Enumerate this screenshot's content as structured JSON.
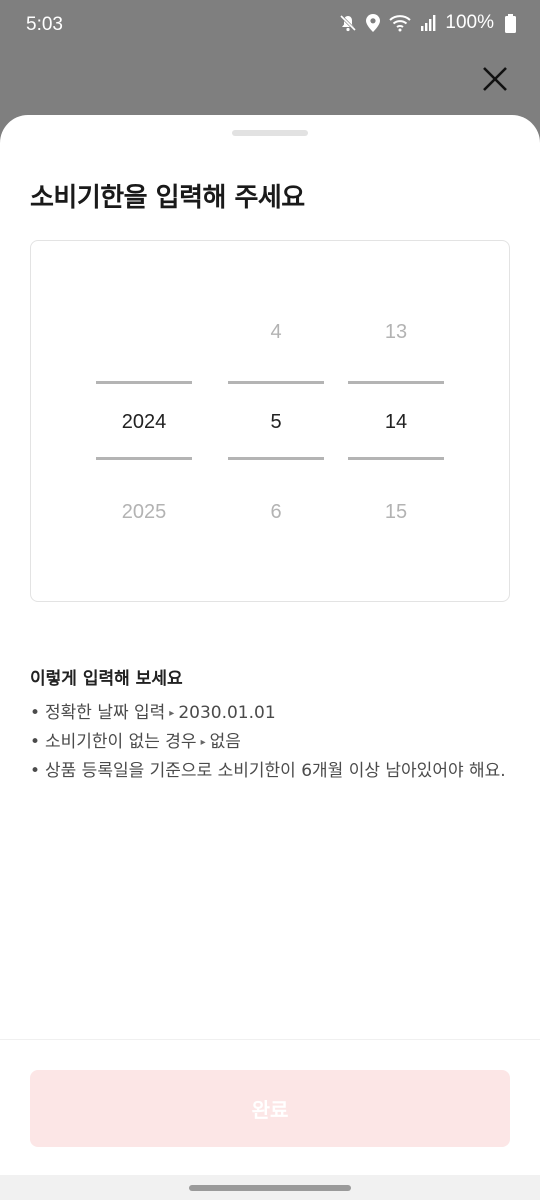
{
  "status_bar": {
    "time": "5:03",
    "battery": "100%"
  },
  "sheet": {
    "title": "소비기한을 입력해 주세요"
  },
  "picker": {
    "year": {
      "prev": "",
      "selected": "2024",
      "next": "2025"
    },
    "month": {
      "prev": "4",
      "selected": "5",
      "next": "6"
    },
    "day": {
      "prev": "13",
      "selected": "14",
      "next": "15"
    }
  },
  "help": {
    "title": "이렇게 입력해 보세요",
    "items": [
      {
        "text": "정확한 날짜 입력",
        "arrow": "▸",
        "example": "2030.01.01"
      },
      {
        "text": "소비기한이 없는 경우",
        "arrow": "▸",
        "example": "없음"
      },
      {
        "text": "상품 등록일을 기준으로 소비기한이 6개월 이상 남아있어야 해요."
      }
    ],
    "bullet": "•"
  },
  "done_button": {
    "label": "완료"
  },
  "colors": {
    "overlay": "#7f7f7f",
    "button_disabled": "#fce6e6"
  }
}
